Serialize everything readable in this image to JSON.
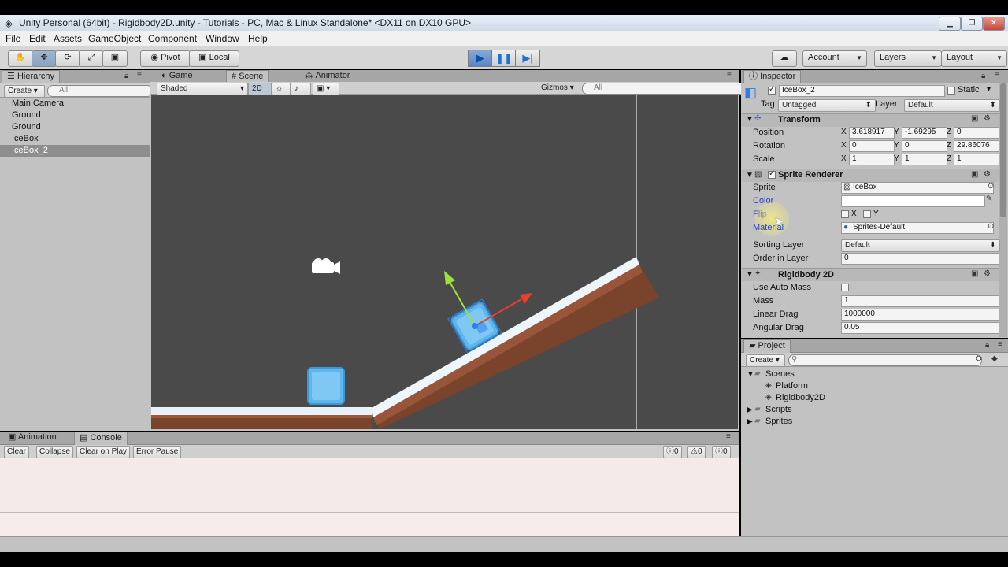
{
  "window": {
    "title": "Unity Personal (64bit) - Rigidbody2D.unity - Tutorials - PC, Mac & Linux Standalone* <DX11 on DX10 GPU>",
    "min_icon": "minimize-icon",
    "max_icon": "maximize-icon",
    "close_icon": "close-icon"
  },
  "menu": [
    "File",
    "Edit",
    "Assets",
    "GameObject",
    "Component",
    "Window",
    "Help"
  ],
  "toolbar": {
    "pivot": "Pivot",
    "local": "Local",
    "account": "Account",
    "layers": "Layers",
    "layout": "Layout"
  },
  "hierarchy": {
    "tab": "Hierarchy",
    "create": "Create",
    "search_placeholder": "All",
    "items": [
      "Main Camera",
      "Ground",
      "Ground",
      "IceBox",
      "IceBox_2"
    ],
    "selected_index": 4
  },
  "scene_tabs": {
    "game": "Game",
    "scene": "Scene",
    "animator": "Animator"
  },
  "scene_bar": {
    "shading": "Shaded",
    "mode2d": "2D",
    "gizmos": "Gizmos",
    "search_placeholder": "All"
  },
  "inspector": {
    "tab": "Inspector",
    "object_name": "IceBox_2",
    "static_label": "Static",
    "tag_label": "Tag",
    "tag_value": "Untagged",
    "layer_label": "Layer",
    "layer_value": "Default",
    "transform": {
      "title": "Transform",
      "position_label": "Position",
      "px": "3.618917",
      "py": "-1.69295",
      "pz": "0",
      "rotation_label": "Rotation",
      "rx": "0",
      "ry": "0",
      "rz": "29.86076",
      "scale_label": "Scale",
      "sx": "1",
      "sy": "1",
      "sz": "1"
    },
    "sprite_renderer": {
      "title": "Sprite Renderer",
      "sprite_label": "Sprite",
      "sprite_value": "IceBox",
      "color_label": "Color",
      "flip_label": "Flip",
      "flip_x": "X",
      "flip_y": "Y",
      "material_label": "Material",
      "material_value": "Sprites-Default",
      "sorting_label": "Sorting Layer",
      "sorting_value": "Default",
      "order_label": "Order in Layer",
      "order_value": "0"
    },
    "rigidbody": {
      "title": "Rigidbody 2D",
      "auto_mass_label": "Use Auto Mass",
      "mass_label": "Mass",
      "mass_value": "1",
      "linear_label": "Linear Drag",
      "linear_value": "1000000",
      "angular_label": "Angular Drag",
      "angular_value": "0.05"
    },
    "axes": {
      "x": "X",
      "y": "Y",
      "z": "Z"
    }
  },
  "project": {
    "tab": "Project",
    "create": "Create",
    "items": [
      {
        "name": "Scenes",
        "kind": "folder-open"
      },
      {
        "name": "Platform",
        "kind": "unity-scene"
      },
      {
        "name": "Rigidbody2D",
        "kind": "unity-scene"
      },
      {
        "name": "Scripts",
        "kind": "folder"
      },
      {
        "name": "Sprites",
        "kind": "folder"
      }
    ]
  },
  "console": {
    "tab_animation": "Animation",
    "tab_console": "Console",
    "clear": "Clear",
    "collapse": "Collapse",
    "clear_on_play": "Clear on Play",
    "error_pause": "Error Pause",
    "count_info": "0",
    "count_warn": "0",
    "count_error": "0"
  }
}
